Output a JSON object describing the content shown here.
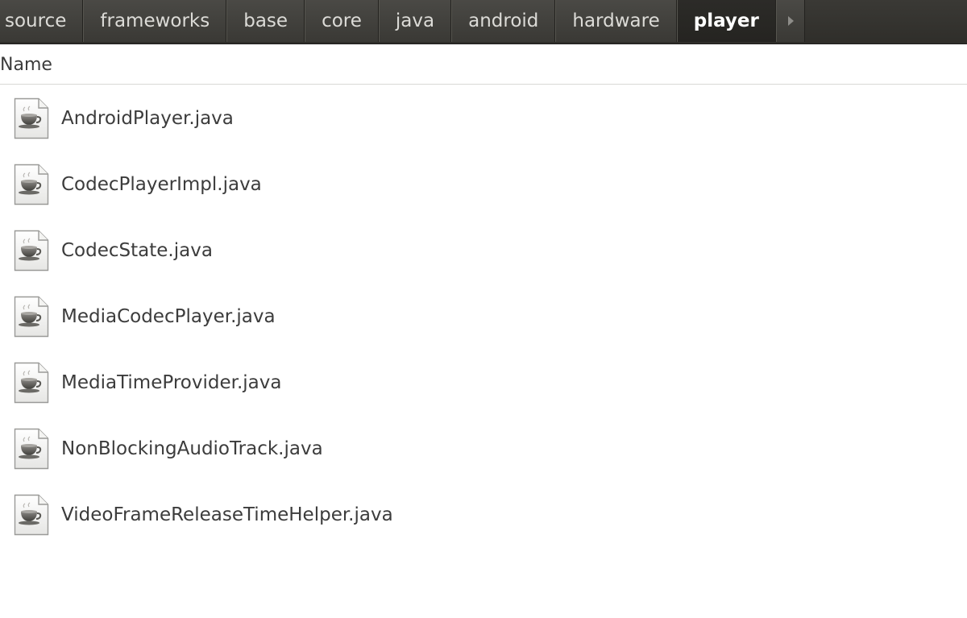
{
  "path_bar": {
    "segments": [
      {
        "label": "source"
      },
      {
        "label": "frameworks"
      },
      {
        "label": "base"
      },
      {
        "label": "core"
      },
      {
        "label": "java"
      },
      {
        "label": "android"
      },
      {
        "label": "hardware"
      },
      {
        "label": "player",
        "active": true
      }
    ],
    "overflow_icon": "triangle-right-icon"
  },
  "list_header": {
    "name_column": "Name"
  },
  "files": [
    {
      "name": "AndroidPlayer.java",
      "icon": "java-coffee-cup-icon"
    },
    {
      "name": "CodecPlayerImpl.java",
      "icon": "java-coffee-cup-icon"
    },
    {
      "name": "CodecState.java",
      "icon": "java-coffee-cup-icon"
    },
    {
      "name": "MediaCodecPlayer.java",
      "icon": "java-coffee-cup-icon"
    },
    {
      "name": "MediaTimeProvider.java",
      "icon": "java-coffee-cup-icon"
    },
    {
      "name": "NonBlockingAudioTrack.java",
      "icon": "java-coffee-cup-icon"
    },
    {
      "name": "VideoFrameReleaseTimeHelper.java",
      "icon": "java-coffee-cup-icon"
    }
  ],
  "colors": {
    "path_bar_bg": "#3a3935",
    "active_segment_bg": "#2c2b28",
    "text": "#3c3c3c"
  }
}
